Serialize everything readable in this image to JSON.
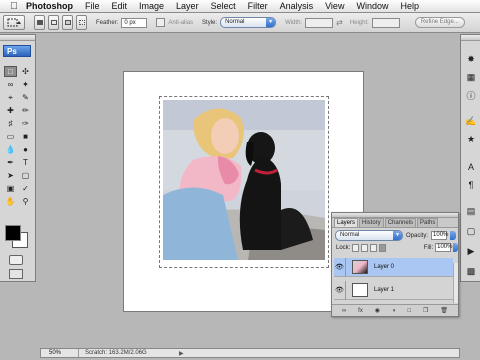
{
  "menubar": {
    "apple_icon": "apple-icon",
    "items": [
      "Photoshop",
      "File",
      "Edit",
      "Image",
      "Layer",
      "Select",
      "Filter",
      "Analysis",
      "View",
      "Window",
      "Help"
    ]
  },
  "options": {
    "feather_label": "Feather:",
    "feather_value": "0 px",
    "antialias_label": "Anti-alias",
    "style_label": "Style:",
    "style_value": "Normal",
    "width_label": "Width:",
    "height_label": "Height:",
    "refine_label": "Refine Edge..."
  },
  "toolbox": {
    "logo": "Ps"
  },
  "layers_panel": {
    "tabs": [
      "Layers",
      "History",
      "Channels",
      "Paths"
    ],
    "blend_mode": "Normal",
    "opacity_label": "Opacity:",
    "opacity_value": "100%",
    "lock_label": "Lock:",
    "fill_label": "Fill:",
    "fill_value": "100%",
    "layers": [
      {
        "name": "Layer 0",
        "selected": true
      },
      {
        "name": "Layer 1",
        "selected": false
      }
    ]
  },
  "status": {
    "zoom": "50%",
    "scratch": "Scratch: 163.2M/2.06G"
  },
  "colors": {
    "selection": "#a9c7f2",
    "foreground": "#000000",
    "background": "#ffffff",
    "accent": "#2f6fcc"
  }
}
